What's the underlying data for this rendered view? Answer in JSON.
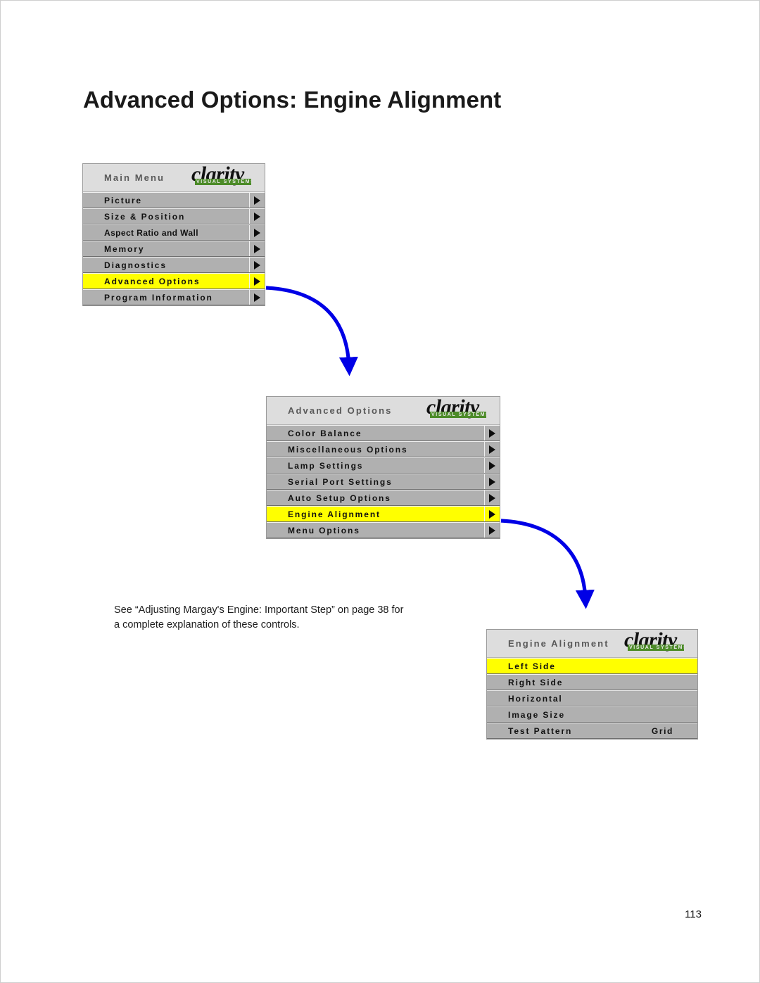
{
  "page": {
    "title": "Advanced Options: Engine Alignment",
    "number": "113",
    "note": "See “Adjusting Margay's Engine: Important Step” on page 38 for a complete explanation of these controls.",
    "accent_blue": "#0000e6",
    "highlight_yellow": "#ffff00",
    "row_gray": "#b0b0b0",
    "header_gray": "#dddddd",
    "logo_green": "#4c8b28"
  },
  "logo": {
    "word": "clarity",
    "tagline": "VISUAL SYSTEMS"
  },
  "panels": [
    {
      "id": "main-menu",
      "header": "Main Menu",
      "rows": [
        {
          "label": "Picture",
          "caret": true,
          "selected": false,
          "wide": true,
          "value": ""
        },
        {
          "label": "Size & Position",
          "caret": true,
          "selected": false,
          "wide": true,
          "value": ""
        },
        {
          "label": "Aspect Ratio and Wall",
          "caret": true,
          "selected": false,
          "wide": false,
          "value": ""
        },
        {
          "label": "Memory",
          "caret": true,
          "selected": false,
          "wide": true,
          "value": ""
        },
        {
          "label": "Diagnostics",
          "caret": true,
          "selected": false,
          "wide": true,
          "value": ""
        },
        {
          "label": "Advanced Options",
          "caret": true,
          "selected": true,
          "wide": true,
          "value": ""
        },
        {
          "label": "Program Information",
          "caret": true,
          "selected": false,
          "wide": true,
          "value": ""
        }
      ]
    },
    {
      "id": "advanced-options",
      "header": "Advanced Options",
      "rows": [
        {
          "label": "Color Balance",
          "caret": true,
          "selected": false,
          "wide": true,
          "value": ""
        },
        {
          "label": "Miscellaneous Options",
          "caret": true,
          "selected": false,
          "wide": true,
          "value": ""
        },
        {
          "label": "Lamp Settings",
          "caret": true,
          "selected": false,
          "wide": true,
          "value": ""
        },
        {
          "label": "Serial Port Settings",
          "caret": true,
          "selected": false,
          "wide": true,
          "value": ""
        },
        {
          "label": "Auto Setup Options",
          "caret": true,
          "selected": false,
          "wide": true,
          "value": ""
        },
        {
          "label": "Engine Alignment",
          "caret": true,
          "selected": true,
          "wide": true,
          "value": ""
        },
        {
          "label": "Menu Options",
          "caret": true,
          "selected": false,
          "wide": true,
          "value": ""
        }
      ]
    },
    {
      "id": "engine-alignment",
      "header": "Engine Alignment",
      "rows": [
        {
          "label": "Left Side",
          "caret": false,
          "selected": true,
          "wide": true,
          "value": ""
        },
        {
          "label": "Right Side",
          "caret": false,
          "selected": false,
          "wide": true,
          "value": ""
        },
        {
          "label": "Horizontal",
          "caret": false,
          "selected": false,
          "wide": true,
          "value": ""
        },
        {
          "label": "Image Size",
          "caret": false,
          "selected": false,
          "wide": true,
          "value": ""
        },
        {
          "label": "Test Pattern",
          "caret": false,
          "selected": false,
          "wide": true,
          "value": "Grid"
        }
      ]
    }
  ],
  "arrows": [
    {
      "from": "main-menu-advanced-options-row",
      "to": "advanced-options-panel"
    },
    {
      "from": "advanced-options-engine-alignment-row",
      "to": "engine-alignment-panel"
    }
  ]
}
